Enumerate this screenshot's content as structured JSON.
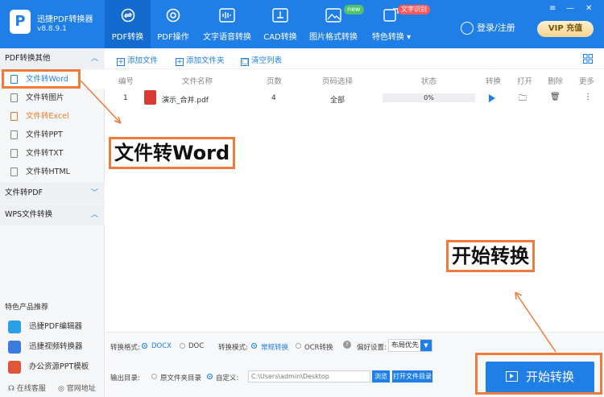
{
  "app": {
    "name": "迅捷PDF转换器",
    "version": "v8.8.9.1",
    "logo_letter": "P"
  },
  "nav": [
    {
      "label": "PDF转换",
      "icon": "convert-icon"
    },
    {
      "label": "PDF操作",
      "icon": "target-icon"
    },
    {
      "label": "文字语音转换",
      "icon": "audio-wave-icon"
    },
    {
      "label": "CAD转换",
      "icon": "cad-icon"
    },
    {
      "label": "图片格式转换",
      "icon": "image-icon"
    },
    {
      "label": "特色转换",
      "icon": "feature-icon"
    }
  ],
  "badges": {
    "new": "new",
    "ocr": "文字识别"
  },
  "account": {
    "login": "登录/注册",
    "vip": "VIP 充值"
  },
  "window": {
    "menu": "≡",
    "minimize": "—",
    "close": "✕"
  },
  "sidebar": {
    "groups": [
      {
        "label": "PDF转换其他",
        "chevron": "︿"
      },
      {
        "label": "文件转PDF",
        "chevron": "﹀"
      },
      {
        "label": "WPS文件转换",
        "chevron": "︿"
      }
    ],
    "items": [
      {
        "label": "文件转Word"
      },
      {
        "label": "文件转图片"
      },
      {
        "label": "文件转Excel"
      },
      {
        "label": "文件转PPT"
      },
      {
        "label": "文件转TXT"
      },
      {
        "label": "文件转HTML"
      }
    ],
    "recommend_title": "特色产品推荐",
    "recommend": [
      {
        "label": "迅捷PDF编辑器"
      },
      {
        "label": "迅捷视频转换器"
      },
      {
        "label": "办公资源PPT模板"
      }
    ],
    "footer": {
      "service": "在线客服",
      "website": "官网地址"
    }
  },
  "toolbar": {
    "add_file": "添加文件",
    "add_folder": "添加文件夹",
    "clear": "清空列表"
  },
  "table": {
    "headers": [
      "编号",
      "文件名称",
      "页数",
      "页码选择",
      "状态",
      "转换",
      "打开",
      "删除",
      "更多"
    ],
    "rows": [
      {
        "index": "1",
        "name": "演示_合并.pdf",
        "pages": "4",
        "range": "全部",
        "progress": 0,
        "progress_text": "0%"
      }
    ]
  },
  "settings": {
    "format_label": "转换格式:",
    "formats": [
      "DOCX",
      "DOC"
    ],
    "mode_label": "转换模式:",
    "modes": [
      "常规转换",
      "OCR转换"
    ],
    "pref_label": "偏好设置:",
    "pref_value": "布局优先",
    "output_label": "输出目录:",
    "output_options": [
      "原文件夹目录",
      "自定义:"
    ],
    "output_path": "C:\\Users\\admin\\Desktop",
    "browse": "浏览",
    "open_folder": "打开文件目录",
    "start": "开始转换"
  },
  "annotations": {
    "word": "文件转Word",
    "start": "开始转换"
  },
  "colors": {
    "primary": "#1f7fe6",
    "annotation": "#f07a3c",
    "excel": "#e07a2a"
  }
}
